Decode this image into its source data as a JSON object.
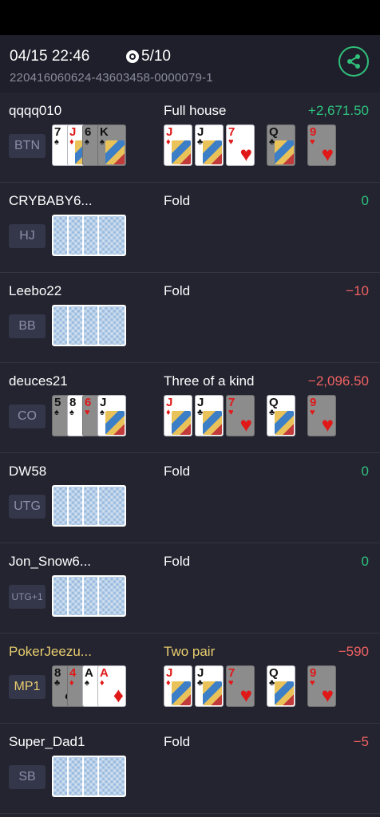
{
  "header": {
    "datetime": "04/15 22:46",
    "blinds": "5/10",
    "hand_id": "220416060624-43603458-0000079-1"
  },
  "colors": {
    "win": "#2ec27e",
    "loss": "#f06262",
    "hero": "#e9cd6e",
    "share": "#2fc07a"
  },
  "players": [
    {
      "name": "qqqq010",
      "position": "BTN",
      "hand": "Full house",
      "result": "+2,671.50",
      "result_kind": "pos",
      "hole_cards": [
        {
          "rank": "7",
          "suit": "♠",
          "color": "blk",
          "dim": false,
          "face": false
        },
        {
          "rank": "J",
          "suit": "♦",
          "color": "red",
          "dim": false,
          "face": true
        },
        {
          "rank": "6",
          "suit": "♠",
          "color": "blk",
          "dim": true,
          "face": false
        },
        {
          "rank": "K",
          "suit": "♠",
          "color": "blk",
          "dim": true,
          "face": true
        }
      ],
      "board": [
        {
          "rank": "J",
          "suit": "♦",
          "color": "red",
          "dim": false,
          "face": true
        },
        {
          "rank": "J",
          "suit": "♣",
          "color": "blk",
          "dim": false,
          "face": true
        },
        {
          "rank": "7",
          "suit": "♥",
          "color": "red",
          "dim": false,
          "face": false
        },
        {
          "rank": "Q",
          "suit": "♣",
          "color": "blk",
          "dim": true,
          "face": true
        },
        {
          "rank": "9",
          "suit": "♥",
          "color": "red",
          "dim": true,
          "face": false
        }
      ]
    },
    {
      "name": "CRYBABY6...",
      "position": "HJ",
      "hand": "Fold",
      "result": "0",
      "result_kind": "zero",
      "hole_cards": "back",
      "board": []
    },
    {
      "name": "Leebo22",
      "position": "BB",
      "hand": "Fold",
      "result": "−10",
      "result_kind": "neg",
      "hole_cards": "back",
      "board": []
    },
    {
      "name": "deuces21",
      "position": "CO",
      "hand": "Three of a kind",
      "result": "−2,096.50",
      "result_kind": "neg",
      "hole_cards": [
        {
          "rank": "5",
          "suit": "♠",
          "color": "blk",
          "dim": true,
          "face": false
        },
        {
          "rank": "8",
          "suit": "♠",
          "color": "blk",
          "dim": false,
          "face": false
        },
        {
          "rank": "6",
          "suit": "♥",
          "color": "red",
          "dim": true,
          "face": false
        },
        {
          "rank": "J",
          "suit": "♠",
          "color": "blk",
          "dim": false,
          "face": true
        }
      ],
      "board": [
        {
          "rank": "J",
          "suit": "♦",
          "color": "red",
          "dim": false,
          "face": true
        },
        {
          "rank": "J",
          "suit": "♣",
          "color": "blk",
          "dim": false,
          "face": true
        },
        {
          "rank": "7",
          "suit": "♥",
          "color": "red",
          "dim": true,
          "face": false
        },
        {
          "rank": "Q",
          "suit": "♣",
          "color": "blk",
          "dim": false,
          "face": true
        },
        {
          "rank": "9",
          "suit": "♥",
          "color": "red",
          "dim": true,
          "face": false
        }
      ]
    },
    {
      "name": "DW58",
      "position": "UTG",
      "hand": "Fold",
      "result": "0",
      "result_kind": "zero",
      "hole_cards": "back",
      "board": []
    },
    {
      "name": "Jon_Snow6...",
      "position": "UTG+1",
      "hand": "Fold",
      "result": "0",
      "result_kind": "zero",
      "hole_cards": "back",
      "board": []
    },
    {
      "name": "PokerJeezu...",
      "position": "MP1",
      "hand": "Two pair",
      "result": "−590",
      "result_kind": "neg",
      "hero": true,
      "hole_cards": [
        {
          "rank": "8",
          "suit": "♣",
          "color": "blk",
          "dim": true,
          "face": false
        },
        {
          "rank": "4",
          "suit": "♦",
          "color": "red",
          "dim": true,
          "face": false
        },
        {
          "rank": "A",
          "suit": "♠",
          "color": "blk",
          "dim": false,
          "face": false
        },
        {
          "rank": "A",
          "suit": "♦",
          "color": "red",
          "dim": false,
          "face": false
        }
      ],
      "board": [
        {
          "rank": "J",
          "suit": "♦",
          "color": "red",
          "dim": false,
          "face": true
        },
        {
          "rank": "J",
          "suit": "♣",
          "color": "blk",
          "dim": false,
          "face": true
        },
        {
          "rank": "7",
          "suit": "♥",
          "color": "red",
          "dim": true,
          "face": false
        },
        {
          "rank": "Q",
          "suit": "♣",
          "color": "blk",
          "dim": false,
          "face": true
        },
        {
          "rank": "9",
          "suit": "♥",
          "color": "red",
          "dim": true,
          "face": false
        }
      ]
    },
    {
      "name": "Super_Dad1",
      "position": "SB",
      "hand": "Fold",
      "result": "−5",
      "result_kind": "neg",
      "hole_cards": "back",
      "board": []
    }
  ]
}
